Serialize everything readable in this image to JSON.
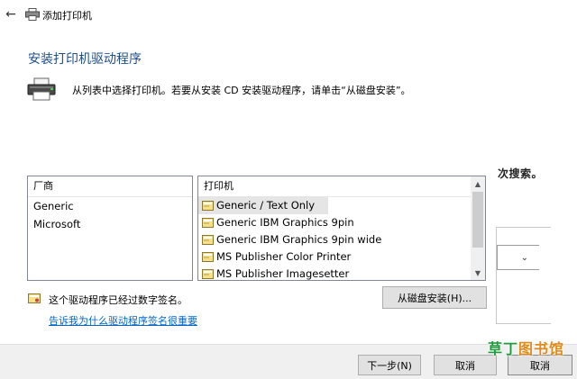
{
  "window": {
    "back_icon": "arrow-left-icon",
    "title_icon": "printer-icon",
    "title": "添加打印机"
  },
  "page": {
    "heading": "安装打印机驱动程序",
    "instructions": "从列表中选择打印机。若要从安装 CD 安装驱动程序，请单击“从磁盘安装”。",
    "behind_text": "次搜索。"
  },
  "manufacturer_list": {
    "header": "厂商",
    "items": [
      "Generic",
      "Microsoft"
    ]
  },
  "printer_list": {
    "header": "打印机",
    "items": [
      "Generic / Text Only",
      "Generic IBM Graphics 9pin",
      "Generic IBM Graphics 9pin wide",
      "MS Publisher Color Printer",
      "MS Publisher Imagesetter"
    ],
    "selected": "Generic / Text Only"
  },
  "driver_info": {
    "signed_text": "这个驱动程序已经过数字签名。",
    "signing_link": "告诉我为什么驱动程序签名很重要"
  },
  "buttons": {
    "have_disk": "从磁盘安装(H)...",
    "next": "下一步(N)",
    "cancel": "取消",
    "cancel_behind": "取消"
  },
  "watermark": {
    "part1": "草丁",
    "part2": "图书馆"
  },
  "colors": {
    "heading": "#1e4e8c",
    "link": "#0066cc",
    "footer_bg": "#f0f0f0",
    "watermark_green": "#1f9b3d",
    "watermark_orange": "#e08a1a"
  }
}
